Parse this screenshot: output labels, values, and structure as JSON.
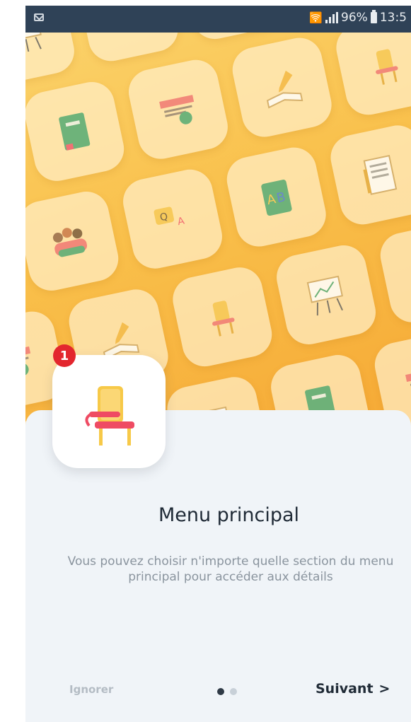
{
  "status_bar": {
    "battery": "96%",
    "time": "13:5"
  },
  "badge": {
    "count": "1"
  },
  "onboarding": {
    "title": "Menu principal",
    "description": "Vous pouvez choisir n'importe quelle section du menu principal pour accéder aux détails"
  },
  "pager": {
    "current_page": 1,
    "total_pages": 2
  },
  "buttons": {
    "skip_label": "Ignorer",
    "next_label": "Suivant",
    "next_chevron": ">"
  },
  "colors": {
    "hero_bg": "#f9c04b",
    "card_bg": "#f0f4f8",
    "badge": "#e3262e",
    "dot_active": "#2f3a46",
    "dot_inactive": "#c8d0d8"
  },
  "icons": {
    "hero_tiles": [
      "chair-icon",
      "teacher-icon",
      "certificate-icon",
      "students-icon",
      "qa-icon",
      "abc-book-icon",
      "exam-paper-icon",
      "notebook-icon",
      "schedule-icon",
      "writing-icon"
    ],
    "main_icon": "school-chair-icon"
  }
}
